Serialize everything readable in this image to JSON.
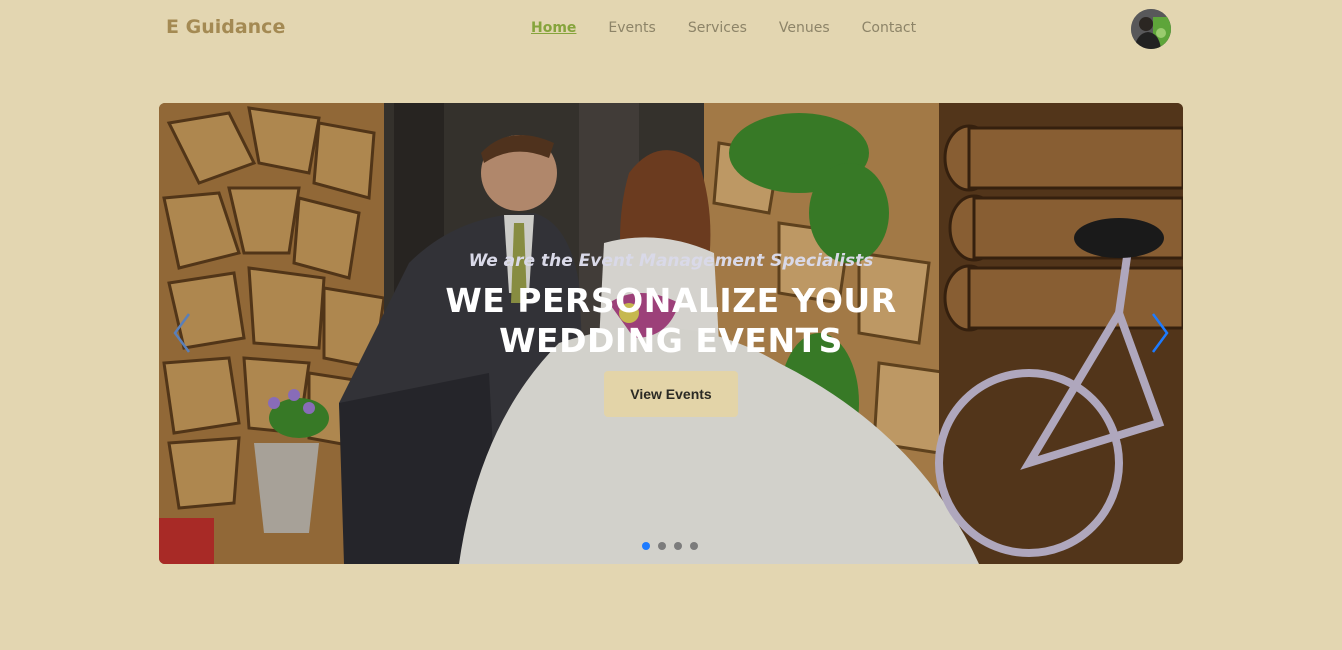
{
  "brand": "E Guidance",
  "nav": {
    "items": [
      {
        "label": "Home",
        "active": true
      },
      {
        "label": "Events",
        "active": false
      },
      {
        "label": "Services",
        "active": false
      },
      {
        "label": "Venues",
        "active": false
      },
      {
        "label": "Contact",
        "active": false
      }
    ]
  },
  "profile": {
    "icon": "avatar-icon"
  },
  "hero": {
    "subtitle": "We are the Event Management Specialists",
    "title": "WE PERSONALIZE YOUR WEDDING EVENTS",
    "cta_label": "View Events",
    "prev_icon": "chevron-left-icon",
    "next_icon": "chevron-right-icon",
    "slide_count": 4,
    "active_slide": 1
  },
  "colors": {
    "background": "#e3d6b1",
    "brand": "#a48a53",
    "nav_active": "#86a43c",
    "indicator_active": "#1d7bff"
  }
}
